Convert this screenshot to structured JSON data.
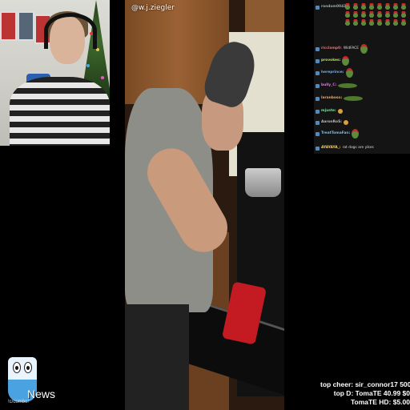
{
  "stream": {
    "source_watermark": "@w.j.ziegler",
    "news_label": "News",
    "news_sub": "!c/combo!",
    "top_cheer": "top cheer: sir_connor17 500",
    "top_d": "top D: TomaTE 40.99 $0",
    "top_hd": "TomaTE HD: $5.00"
  },
  "chat": {
    "emote_count": 24,
    "messages": [
      {
        "user": "random0042",
        "text": "",
        "color": "#9aa"
      },
      {
        "user": "ricclamp0:",
        "text": "WidFACE",
        "color": "#c77",
        "emote": "pepe"
      },
      {
        "user": "provokes:",
        "text": "",
        "color": "#bd7",
        "emote": "pepe"
      },
      {
        "user": "hereprince:",
        "text": "",
        "color": "#7ad",
        "emote": "pepe"
      },
      {
        "user": "bully_C:",
        "text": "",
        "color": "#d7d",
        "emote": "wide"
      },
      {
        "user": "laranboso:",
        "text": "",
        "color": "#da7",
        "emote": "wide"
      },
      {
        "user": "mjuste:",
        "text": "",
        "color": "#7d9",
        "emote": "dot"
      },
      {
        "user": "AaronRoS:",
        "text": "",
        "color": "#bbb",
        "emote": "dot"
      },
      {
        "user": "TreatTomaFan:",
        "text": "",
        "color": "#8bd",
        "emote": "pepe"
      },
      {
        "user": "AYAYAYA_:",
        "text": "rat dogs are yikes",
        "color": "#ec7"
      }
    ]
  },
  "colors": {
    "background": "#000000",
    "chat_bg": "#141414",
    "towel": "#c41a22",
    "emote_green": "#5b8a3a",
    "santa_red": "#c8262c"
  }
}
